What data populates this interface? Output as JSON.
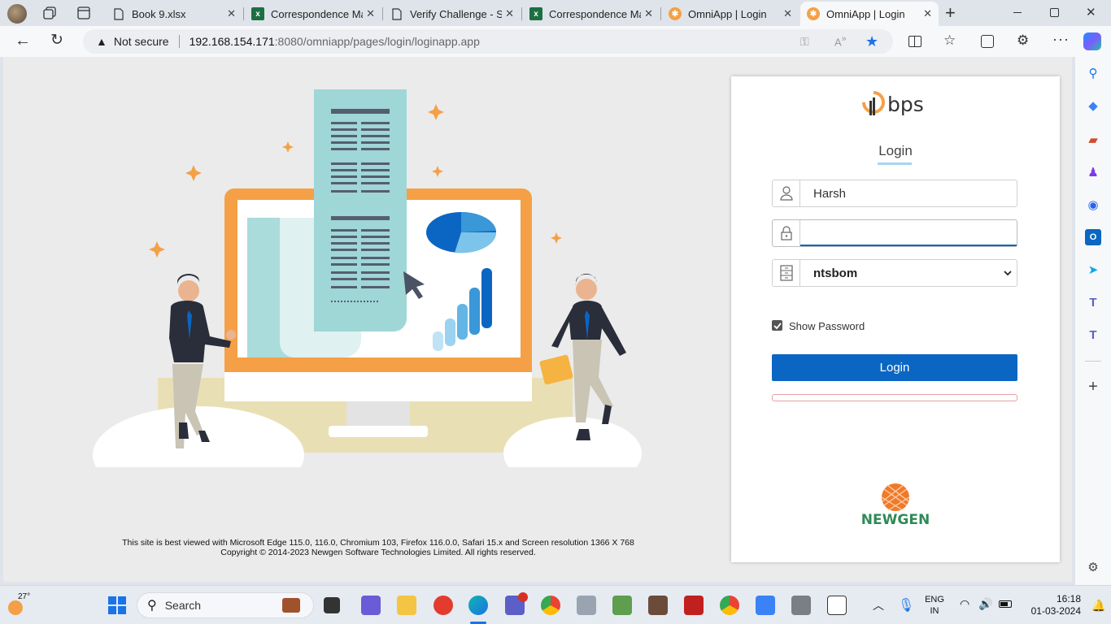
{
  "browser": {
    "tabs": [
      {
        "title": "Book 9.xlsx",
        "icon": "document-icon"
      },
      {
        "title": "Correspondence Ma",
        "icon": "excel-icon"
      },
      {
        "title": "Verify Challenge - S",
        "icon": "document-icon"
      },
      {
        "title": "Correspondence Ma",
        "icon": "excel-icon"
      },
      {
        "title": "OmniApp | Login",
        "icon": "omniapp-icon"
      },
      {
        "title": "OmniApp | Login",
        "icon": "omniapp-icon",
        "active": true
      }
    ],
    "security_label": "Not secure",
    "url_host": "192.168.154.171",
    "url_rest": ":8080/omniapp/pages/login/loginapp.app"
  },
  "login": {
    "logo_text": "bps",
    "heading": "Login",
    "username_value": "Harsh",
    "password_value": "",
    "cabinet_selected": "ntsbom",
    "show_password_label": "Show Password",
    "show_password_checked": true,
    "login_button_label": "Login",
    "brand_footer": "NEWGEN"
  },
  "footer": {
    "line1": "This site is best viewed with Microsoft Edge 115.0, 116.0, Chromium 103, Firefox 116.0.0, Safari 15.x and Screen resolution 1366 X 768",
    "line2": "Copyright © 2014-2023 Newgen Software Technologies Limited. All rights reserved."
  },
  "taskbar": {
    "weather_temp": "27°",
    "search_placeholder": "Search",
    "lang_line1": "ENG",
    "lang_line2": "IN",
    "time": "16:18",
    "date": "01-03-2024"
  },
  "colors": {
    "accent_blue": "#0a66c2",
    "orange": "#f5a046",
    "newgen_green": "#2e8b57"
  }
}
